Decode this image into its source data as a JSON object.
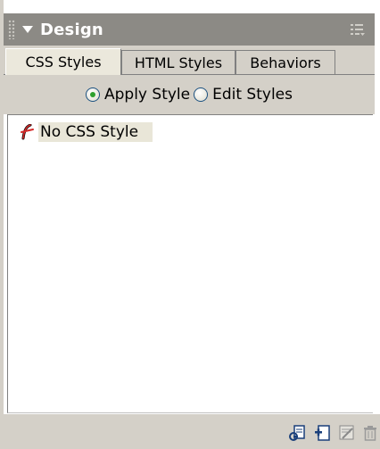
{
  "panel": {
    "title": "Design",
    "icons": {
      "collapse": "collapse-arrow-icon",
      "options": "panel-options-icon"
    }
  },
  "tabs": [
    {
      "label": "CSS Styles",
      "active": true
    },
    {
      "label": "HTML Styles",
      "active": false
    },
    {
      "label": "Behaviors",
      "active": false
    }
  ],
  "mode": {
    "apply_label": "Apply Style",
    "edit_label": "Edit Styles",
    "selected": "apply"
  },
  "styles_list": [
    {
      "label": "No CSS Style",
      "icon": "no-style-icon"
    }
  ],
  "footer_buttons": [
    {
      "name": "attach-stylesheet-button",
      "icon": "attach-stylesheet-icon"
    },
    {
      "name": "new-style-button",
      "icon": "new-style-icon"
    },
    {
      "name": "edit-style-button",
      "icon": "edit-style-icon"
    },
    {
      "name": "delete-style-button",
      "icon": "trash-icon"
    }
  ],
  "colors": {
    "titlebar": "#8c8a85",
    "panel_bg": "#d4d0c8",
    "active_tab": "#ebe8dc",
    "radio_dot": "#2ea02e"
  }
}
